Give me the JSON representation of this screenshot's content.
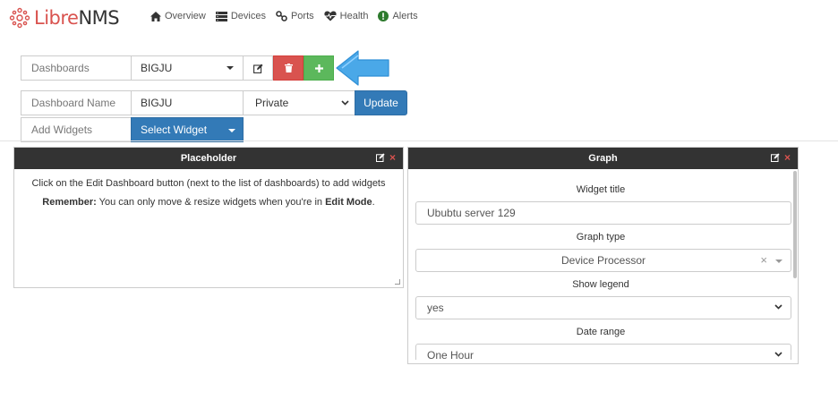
{
  "brand": {
    "libre": "Libre",
    "nms": "NMS"
  },
  "nav": [
    {
      "label": "Overview",
      "icon": "home-icon"
    },
    {
      "label": "Devices",
      "icon": "server-icon"
    },
    {
      "label": "Ports",
      "icon": "link-icon"
    },
    {
      "label": "Health",
      "icon": "heartbeat-icon"
    },
    {
      "label": "Alerts",
      "icon": "exclamation-circle-icon"
    }
  ],
  "dashboards": {
    "label": "Dashboards",
    "selected": "BIGJU"
  },
  "dashboard_name": {
    "label": "Dashboard Name",
    "value": "BIGJU",
    "access": "Private",
    "update_label": "Update"
  },
  "add_widgets": {
    "label": "Add Widgets",
    "select_label": "Select Widget"
  },
  "placeholder_widget": {
    "title": "Placeholder",
    "line1": "Click on the Edit Dashboard button (next to the list of dashboards) to add widgets",
    "remember_bold": "Remember:",
    "remember_text": " You can only move & resize widgets when you're in ",
    "edit_mode": "Edit Mode",
    "period": "."
  },
  "graph_widget": {
    "title": "Graph",
    "widget_title_label": "Widget title",
    "widget_title_value": "Ububtu server 129",
    "graph_type_label": "Graph type",
    "graph_type_value": "Device Processor",
    "clear_symbol": "×",
    "show_legend_label": "Show legend",
    "show_legend_value": "yes",
    "date_range_label": "Date range",
    "date_range_value": "One Hour"
  },
  "colors": {
    "brand_red": "#d9534f",
    "primary": "#337ab7",
    "danger": "#d9534f",
    "success": "#5cb85c",
    "widget_header": "#333333",
    "arrow": "#4aa8e8"
  }
}
